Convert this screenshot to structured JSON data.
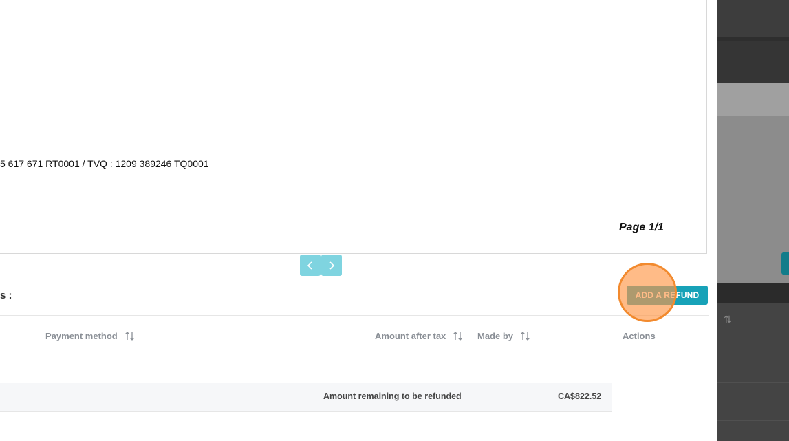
{
  "document": {
    "tax_line": "5 617 671 RT0001 / TVQ : 1209 389246 TQ0001",
    "page_label": "Page 1/1"
  },
  "pager": {
    "prev_icon": "chevron-left-icon",
    "next_icon": "chevron-right-icon"
  },
  "refunds": {
    "section_title": "s :",
    "add_button_label": "ADD A REFUND",
    "columns": [
      {
        "label": "Payment method",
        "sortable": true
      },
      {
        "label": "Amount after tax",
        "sortable": true
      },
      {
        "label": "Made by",
        "sortable": true
      },
      {
        "label": "Actions",
        "sortable": false
      }
    ],
    "summary": {
      "label": "Amount remaining to be refunded",
      "value": "CA$822.52"
    }
  },
  "colors": {
    "accent": "#17a2b8",
    "pager": "#7fd4e0",
    "click_marker": "#f28a2e"
  }
}
